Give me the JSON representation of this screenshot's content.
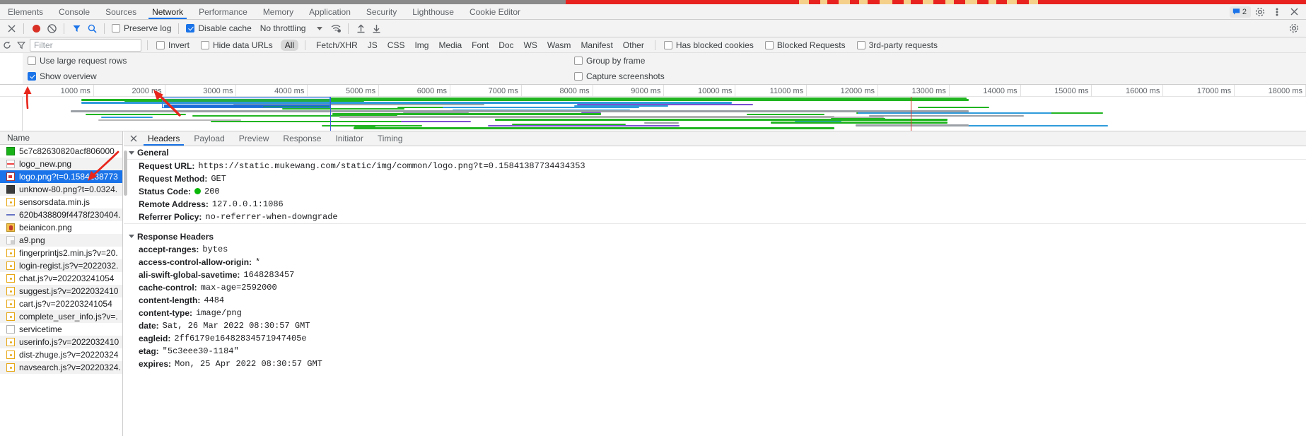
{
  "devtools": {
    "tabs": [
      {
        "label": "Elements",
        "active": false
      },
      {
        "label": "Console",
        "active": false
      },
      {
        "label": "Sources",
        "active": false
      },
      {
        "label": "Network",
        "active": true
      },
      {
        "label": "Performance",
        "active": false
      },
      {
        "label": "Memory",
        "active": false
      },
      {
        "label": "Application",
        "active": false
      },
      {
        "label": "Security",
        "active": false
      },
      {
        "label": "Lighthouse",
        "active": false
      },
      {
        "label": "Cookie Editor",
        "active": false
      }
    ],
    "warning_count": "2",
    "warning_icon": "chat-bubble-icon",
    "settings_icon": "gear-icon",
    "more_icon": "kebab-menu-icon",
    "close_icon": "close-icon"
  },
  "toolbar": {
    "clear_icon": "close-icon",
    "record_icon": "record-dot-icon",
    "clear_network_icon": "no-entry-icon",
    "filter_icon": "funnel-icon",
    "search_icon": "magnifier-icon",
    "preserve_log_label": "Preserve log",
    "preserve_log_checked": false,
    "disable_cache_label": "Disable cache",
    "disable_cache_checked": true,
    "throttling_label": "No throttling",
    "wifi_icon": "wifi-settings-icon",
    "import_icon": "import-har-icon",
    "export_icon": "export-har-icon",
    "settings_icon": "gear-icon"
  },
  "filterbar": {
    "reload_icon": "reload-icon",
    "funnel_icon": "funnel-icon",
    "search_placeholder": "Filter",
    "search_value": "",
    "invert_label": "Invert",
    "invert_checked": false,
    "hide_data_urls_label": "Hide data URLs",
    "hide_data_urls_checked": false,
    "types": [
      {
        "label": "All",
        "selected": true
      },
      {
        "label": "Fetch/XHR",
        "selected": false
      },
      {
        "label": "JS",
        "selected": false
      },
      {
        "label": "CSS",
        "selected": false
      },
      {
        "label": "Img",
        "selected": false
      },
      {
        "label": "Media",
        "selected": false
      },
      {
        "label": "Font",
        "selected": false
      },
      {
        "label": "Doc",
        "selected": false
      },
      {
        "label": "WS",
        "selected": false
      },
      {
        "label": "Wasm",
        "selected": false
      },
      {
        "label": "Manifest",
        "selected": false
      },
      {
        "label": "Other",
        "selected": false
      }
    ],
    "has_blocked_cookies_label": "Has blocked cookies",
    "has_blocked_cookies_checked": false,
    "blocked_requests_label": "Blocked Requests",
    "blocked_requests_checked": false,
    "third_party_label": "3rd-party requests",
    "third_party_checked": false
  },
  "options": {
    "use_large_rows_label": "Use large request rows",
    "use_large_rows_checked": false,
    "group_by_frame_label": "Group by frame",
    "group_by_frame_checked": false,
    "show_overview_label": "Show overview",
    "show_overview_checked": true,
    "capture_screenshots_label": "Capture screenshots",
    "capture_screenshots_checked": false
  },
  "overview": {
    "ticks": [
      "1000 ms",
      "2000 ms",
      "3000 ms",
      "4000 ms",
      "5000 ms",
      "6000 ms",
      "7000 ms",
      "8000 ms",
      "9000 ms",
      "10000 ms",
      "11000 ms",
      "12000 ms",
      "13000 ms",
      "14000 ms",
      "15000 ms",
      "16000 ms",
      "17000 ms",
      "18000 ms"
    ],
    "annotation_arrow_1": "red-arrow-annotation",
    "annotation_arrow_2": "red-arrow-annotation",
    "selection_window": "overview-selection-window"
  },
  "requests": {
    "column_header": "Name",
    "items": [
      {
        "name": "5c7c82630820acf806000.",
        "icon": "green-thumb-icon",
        "selected": false
      },
      {
        "name": "logo_new.png",
        "icon": "image-thumb-icon",
        "selected": false
      },
      {
        "name": "logo.png?t=0.1584138773",
        "icon": "image-thumb-icon",
        "selected": true
      },
      {
        "name": "unknow-80.png?t=0.0324.",
        "icon": "dark-thumb-icon",
        "selected": false
      },
      {
        "name": "sensorsdata.min.js",
        "icon": "js-file-icon",
        "selected": false
      },
      {
        "name": "620b438809f4478f230404.",
        "icon": "line-thumb-icon",
        "selected": false
      },
      {
        "name": "beianicon.png",
        "icon": "favicon-thumb-icon",
        "selected": false
      },
      {
        "name": "a9.png",
        "icon": "image-placeholder-icon",
        "selected": false
      },
      {
        "name": "fingerprintjs2.min.js?v=20.",
        "icon": "js-file-icon",
        "selected": false
      },
      {
        "name": "login-regist.js?v=2022032.",
        "icon": "js-file-icon",
        "selected": false
      },
      {
        "name": "chat.js?v=202203241054",
        "icon": "js-file-icon",
        "selected": false
      },
      {
        "name": "suggest.js?v=2022032410",
        "icon": "js-file-icon",
        "selected": false
      },
      {
        "name": "cart.js?v=202203241054",
        "icon": "js-file-icon",
        "selected": false
      },
      {
        "name": "complete_user_info.js?v=.",
        "icon": "js-file-icon",
        "selected": false
      },
      {
        "name": "servicetime",
        "icon": "doc-file-icon",
        "selected": false
      },
      {
        "name": "userinfo.js?v=2022032410",
        "icon": "js-file-icon",
        "selected": false
      },
      {
        "name": "dist-zhuge.js?v=20220324",
        "icon": "js-file-icon",
        "selected": false
      },
      {
        "name": "navsearch.js?v=20220324.",
        "icon": "js-file-icon",
        "selected": false
      }
    ]
  },
  "details": {
    "close_icon": "close-icon",
    "tabs": [
      {
        "label": "Headers",
        "active": true
      },
      {
        "label": "Payload",
        "active": false
      },
      {
        "label": "Preview",
        "active": false
      },
      {
        "label": "Response",
        "active": false
      },
      {
        "label": "Initiator",
        "active": false
      },
      {
        "label": "Timing",
        "active": false
      }
    ],
    "general_section": "General",
    "general": [
      {
        "key": "Request URL:",
        "value": "https://static.mukewang.com/static/img/common/logo.png?t=0.15841387734434353",
        "status": false
      },
      {
        "key": "Request Method:",
        "value": "GET",
        "status": false
      },
      {
        "key": "Status Code:",
        "value": "200",
        "status": true
      },
      {
        "key": "Remote Address:",
        "value": "127.0.0.1:1086",
        "status": false
      },
      {
        "key": "Referrer Policy:",
        "value": "no-referrer-when-downgrade",
        "status": false
      }
    ],
    "response_section": "Response Headers",
    "response": [
      {
        "key": "accept-ranges:",
        "value": "bytes"
      },
      {
        "key": "access-control-allow-origin:",
        "value": "*"
      },
      {
        "key": "ali-swift-global-savetime:",
        "value": "1648283457"
      },
      {
        "key": "cache-control:",
        "value": "max-age=2592000"
      },
      {
        "key": "content-length:",
        "value": "4484"
      },
      {
        "key": "content-type:",
        "value": "image/png"
      },
      {
        "key": "date:",
        "value": "Sat, 26 Mar 2022 08:30:57 GMT"
      },
      {
        "key": "eagleid:",
        "value": "2ff6179e16482834571947405e"
      },
      {
        "key": "etag:",
        "value": "\"5c3eee30-1184\""
      },
      {
        "key": "expires:",
        "value": "Mon, 25 Apr 2022 08:30:57 GMT"
      }
    ]
  },
  "colors": {
    "accent": "#1a73e8",
    "record": "#d93025",
    "status_ok": "#0ab80a",
    "annotation": "#e8261c",
    "toolbar_bg": "#f3f3f3"
  }
}
